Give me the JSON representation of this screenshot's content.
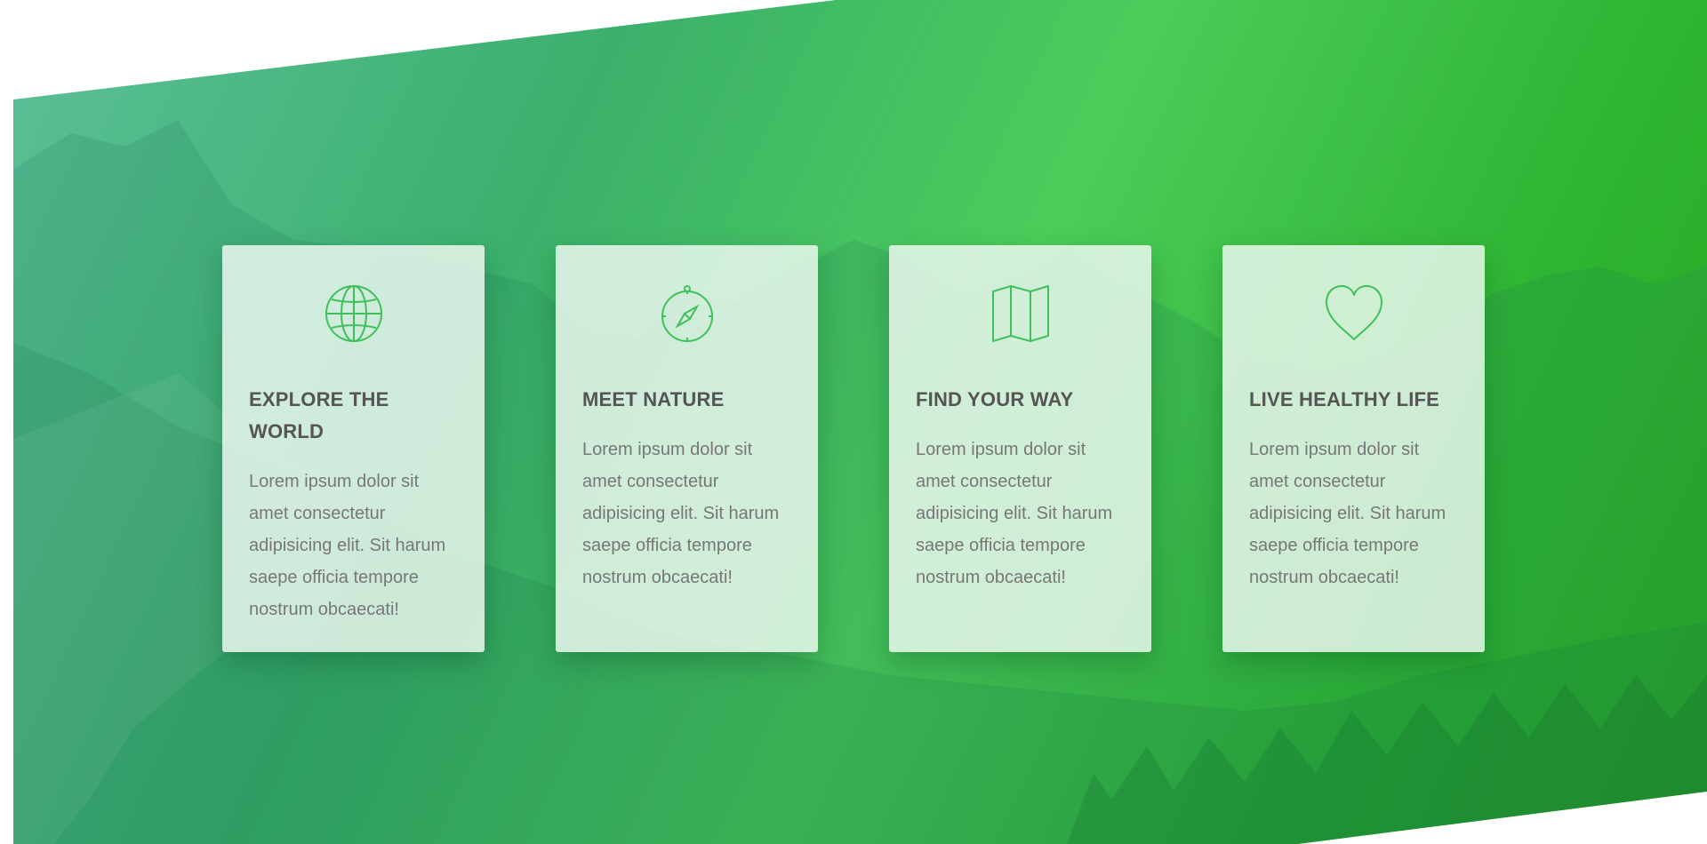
{
  "colors": {
    "accent": "#3fc05a",
    "gradient_start": "#5cc09a",
    "gradient_end": "#2aa820",
    "card_background": "#eef8f1",
    "heading_text": "#555555",
    "body_text": "#777777"
  },
  "features": [
    {
      "icon": "globe-icon",
      "title": "Explore the world",
      "text": "Lorem ipsum dolor sit amet consectetur adipisicing elit. Sit harum saepe officia tempore nostrum obcaecati!"
    },
    {
      "icon": "compass-icon",
      "title": "Meet nature",
      "text": "Lorem ipsum dolor sit amet consectetur adipisicing elit. Sit harum saepe officia tempore nostrum obcaecati!"
    },
    {
      "icon": "map-icon",
      "title": "Find your way",
      "text": "Lorem ipsum dolor sit amet consectetur adipisicing elit. Sit harum saepe officia tempore nostrum obcaecati!"
    },
    {
      "icon": "heart-icon",
      "title": "Live healthy life",
      "text": "Lorem ipsum dolor sit amet consectetur adipisicing elit. Sit harum saepe officia tempore nostrum obcaecati!"
    }
  ]
}
